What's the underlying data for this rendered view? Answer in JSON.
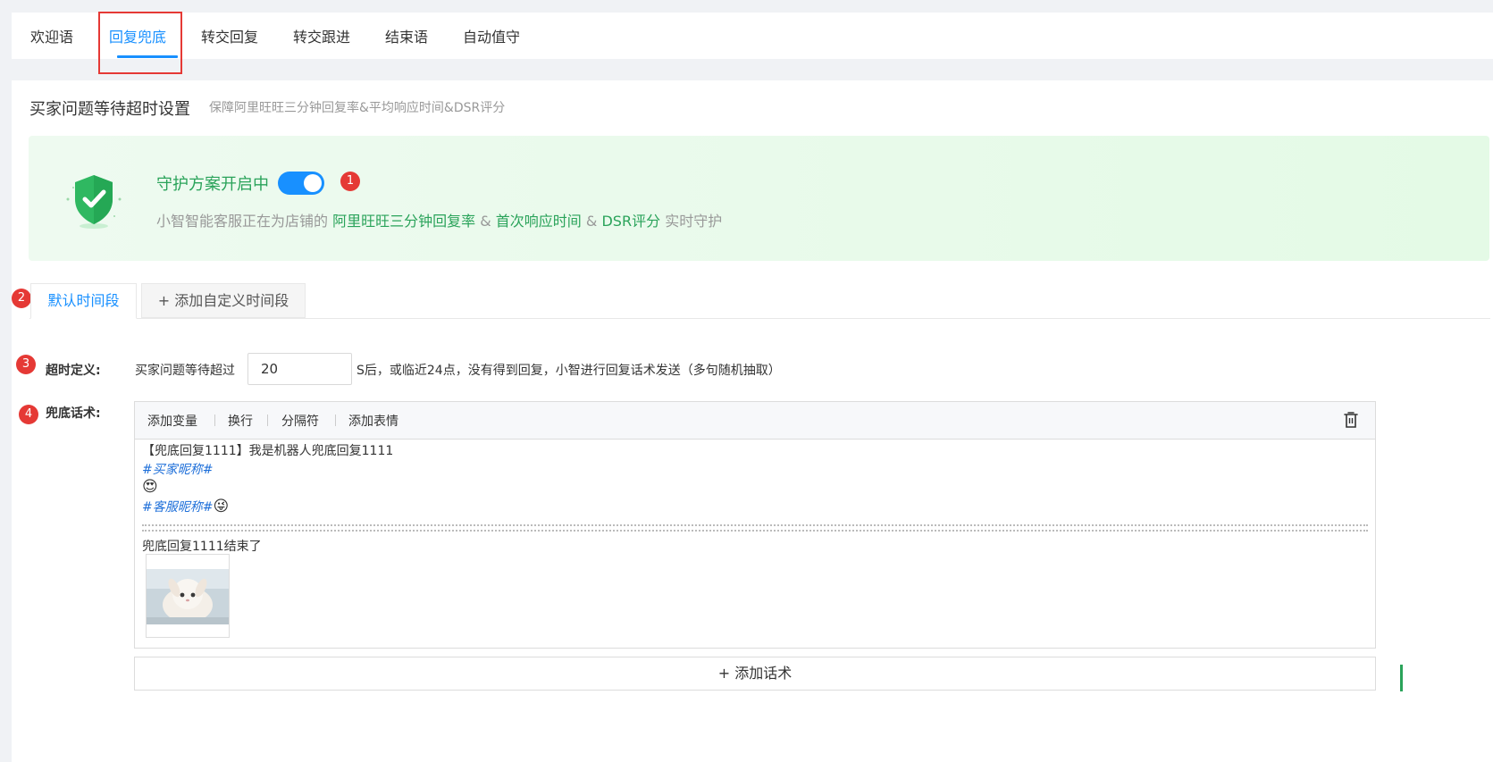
{
  "top_tabs": [
    {
      "label": "欢迎语"
    },
    {
      "label": "回复兜底"
    },
    {
      "label": "转交回复"
    },
    {
      "label": "转交跟进"
    },
    {
      "label": "结束语"
    },
    {
      "label": "自动值守"
    }
  ],
  "active_tab": "回复兜底",
  "section": {
    "title": "买家问题等待超时设置",
    "subtitle": "保障阿里旺旺三分钟回复率&平均响应时间&DSR评分"
  },
  "guard": {
    "title": "守护方案开启中",
    "toggle_on": true,
    "desc_prefix": "小智智能客服正在为店铺的",
    "metric1": "阿里旺旺三分钟回复率",
    "amp1": "&",
    "metric2": "首次响应时间",
    "amp2": "&",
    "metric3": "DSR评分",
    "desc_suffix": "实时守护"
  },
  "badges": {
    "b1": "1",
    "b2": "2",
    "b3": "3",
    "b4": "4"
  },
  "time_tabs": {
    "default": "默认时间段",
    "add_custom": "+ 添加自定义时间段"
  },
  "timeout": {
    "label": "超时定义:",
    "prefix": "买家问题等待超过",
    "value": "20",
    "suffix": "S后，或临近24点，没有得到回复，小智进行回复话术发送（多句随机抽取）"
  },
  "script": {
    "label": "兜底话术:",
    "toolbar": {
      "add_variable": "添加变量",
      "line_break": "换行",
      "separator": "分隔符",
      "add_emoji": "添加表情"
    },
    "lines": {
      "line1": "【兜底回复1111】我是机器人兜底回复1111",
      "buyer_var": "#买家昵称#",
      "agent_var": "#客服昵称#",
      "line_end": "兜底回复1111结束了"
    },
    "emojis": {
      "e1": "😍",
      "e2": "😜"
    }
  },
  "add_script_label": "+  添加话术",
  "colors": {
    "accent": "#1890ff",
    "green": "#2aa35a",
    "badge_red": "#e53935"
  }
}
